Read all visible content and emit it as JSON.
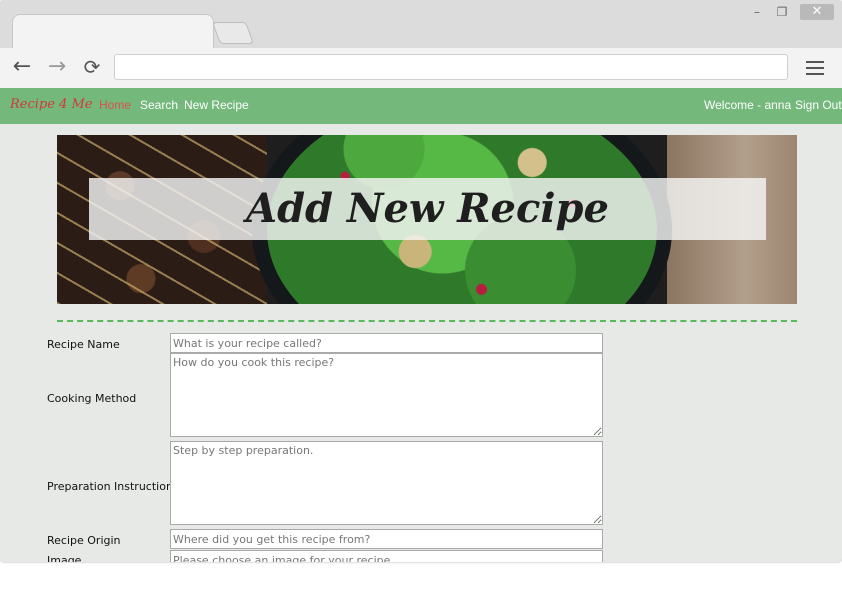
{
  "browser": {
    "window_controls": {
      "minimize": "–",
      "maximize": "❐",
      "close": "✕"
    },
    "nav": {
      "back_icon": "←",
      "forward_icon": "→",
      "reload_icon": "⟳"
    },
    "address": {
      "value": ""
    }
  },
  "site": {
    "brand": "Recipe 4 Me",
    "nav": {
      "home": "Home",
      "search": "Search",
      "new_recipe": "New Recipe"
    },
    "user": {
      "welcome": "Welcome - anna",
      "sign_out": "Sign Out"
    },
    "colors": {
      "navbar": "#74b87b",
      "active_link": "#d9534f",
      "divider": "#5cb85c"
    }
  },
  "banner": {
    "title": "Add New Recipe"
  },
  "form": {
    "recipe_name": {
      "label": "Recipe Name",
      "placeholder": "What is your recipe called?"
    },
    "cooking_method": {
      "label": "Cooking Method",
      "placeholder": "How do you cook this recipe?"
    },
    "preparation": {
      "label": "Preparation Instructions",
      "placeholder": "Step by step preparation."
    },
    "origin": {
      "label": "Recipe Origin",
      "placeholder": "Where did you get this recipe from?"
    },
    "image": {
      "label": "Image",
      "placeholder": "Please choose an image for your recipe."
    }
  }
}
